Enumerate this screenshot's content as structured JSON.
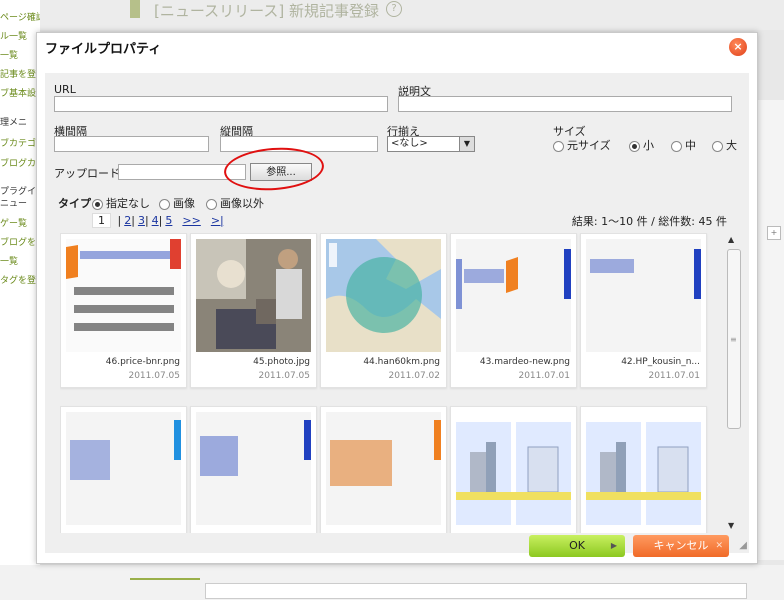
{
  "background": {
    "sidebar": [
      "ページ確認",
      "ル一覧",
      "一覧",
      "記事を登",
      "ブ基本設",
      "理メニ",
      "ブカテゴリ",
      "ブログカ",
      "プラグイ",
      "ニュー",
      "ゲー覧",
      "ブログを",
      "一覧",
      "タグを登"
    ],
    "page_title": "[ニュースリリース] 新規記事登録",
    "help_icon": "?"
  },
  "dialog": {
    "title": "ファイルプロパティ",
    "close_icon": "×",
    "url_label": "URL",
    "desc_label": "説明文",
    "hspace_label": "横間隔",
    "vspace_label": "縦間隔",
    "align_label": "行揃え",
    "align_value": "<なし>",
    "size_label": "サイズ",
    "size_options": [
      "元サイズ",
      "小",
      "中",
      "大"
    ],
    "size_selected": 1,
    "upload_label": "アップロード",
    "browse_label": "参照...",
    "type_label": "タイプ",
    "type_options": [
      "指定なし",
      "画像",
      "画像以外"
    ],
    "type_selected": 0,
    "pager": {
      "current": "1",
      "pages": [
        "2",
        "3",
        "4",
        "5"
      ],
      "next": ">>",
      "last": ">|"
    },
    "result_text": "結果: 1〜10 件 / 総件数: 45 件",
    "files": [
      {
        "name": "46.price-bnr.png",
        "date": "2011.07.05"
      },
      {
        "name": "45.photo.jpg",
        "date": "2011.07.05"
      },
      {
        "name": "44.han60km.png",
        "date": "2011.07.02"
      },
      {
        "name": "43.mardeo-new.png",
        "date": "2011.07.01"
      },
      {
        "name": "42.HP_kousin_n...",
        "date": "2011.07.01"
      },
      {
        "name": "",
        "date": ""
      },
      {
        "name": "",
        "date": ""
      },
      {
        "name": "",
        "date": ""
      },
      {
        "name": "",
        "date": ""
      },
      {
        "name": "",
        "date": ""
      }
    ],
    "ok_label": "OK",
    "cancel_label": "キャンセル",
    "colors": {
      "ok": "#8cc820",
      "cancel": "#f06a28",
      "close": "#e0401a",
      "annotation": "#e01010"
    }
  }
}
